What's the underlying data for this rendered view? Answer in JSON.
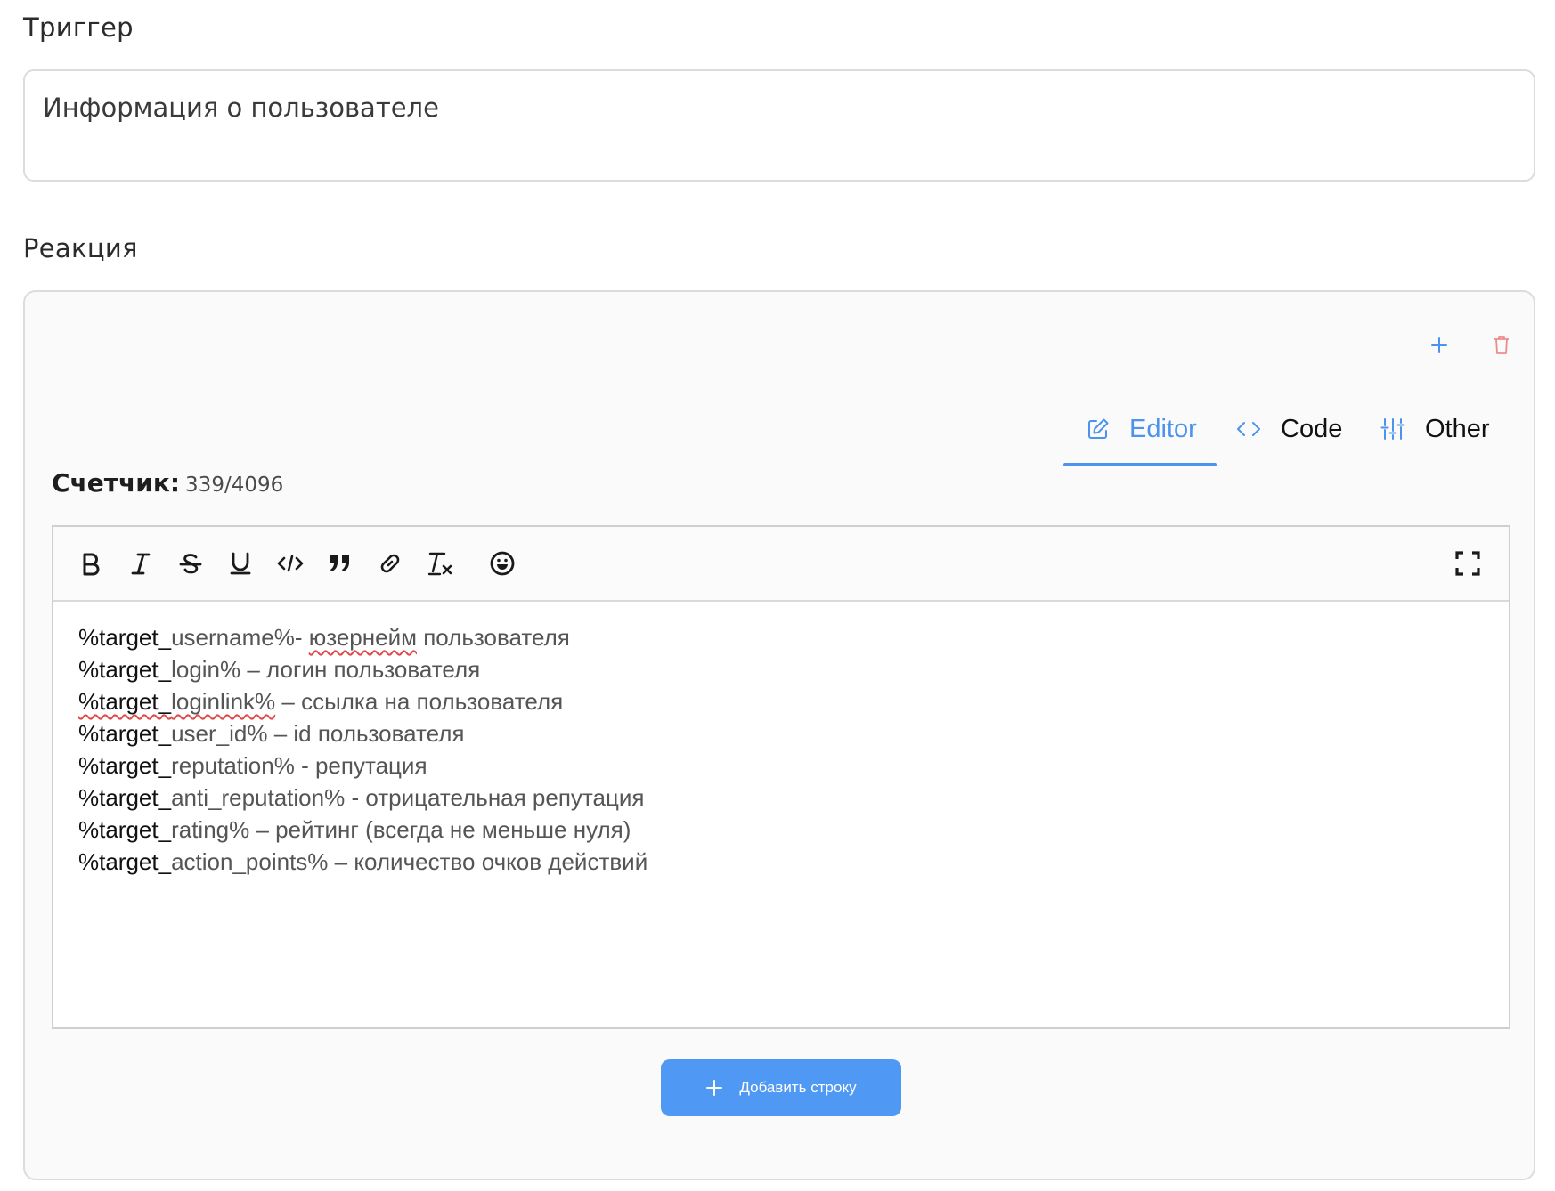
{
  "trigger": {
    "label": "Триггер",
    "value": "Информация о пользователе"
  },
  "reaction": {
    "label": "Реакция",
    "actions": {
      "add_icon": "plus-icon",
      "delete_icon": "trash-icon"
    },
    "tabs": [
      {
        "label": "Editor",
        "icon": "edit-icon",
        "active": true
      },
      {
        "label": "Code",
        "icon": "code-icon",
        "active": false
      },
      {
        "label": "Other",
        "icon": "sliders-icon",
        "active": false
      }
    ],
    "counter": {
      "label": "Счетчик:",
      "value": "339/4096"
    },
    "toolbar": {
      "buttons": [
        "bold-icon",
        "italic-icon",
        "strikethrough-icon",
        "underline-icon",
        "code-inline-icon",
        "quote-icon",
        "link-icon",
        "clear-format-icon",
        "emoji-icon"
      ],
      "fullscreen_icon": "fullscreen-icon"
    },
    "content": {
      "lines": [
        {
          "prefix": "%target_",
          "var": "username%",
          "desc": "- юзернейм пользователя"
        },
        {
          "prefix": "%target_",
          "var": "login%",
          "desc": " – логин пользователя"
        },
        {
          "prefix": "%target_",
          "var": "loginlink%",
          "desc": " – ссылка на пользователя"
        },
        {
          "prefix": "%target_",
          "var": "user_id%",
          "desc": " – id пользователя"
        },
        {
          "prefix": "%target_",
          "var": "reputation%",
          "desc": " - репутация"
        },
        {
          "prefix": "%target_",
          "var": "anti_reputation%",
          "desc": " - отрицательная репутация"
        },
        {
          "prefix": "%target_",
          "var": "rating%",
          "desc": " – рейтинг (всегда не меньше нуля)"
        },
        {
          "prefix": "%target_",
          "var": "action_points%",
          "desc": " – количество очков действий"
        }
      ]
    },
    "add_row_button": "Добавить строку"
  },
  "colors": {
    "accent": "#4c93ee",
    "button": "#4f98f3",
    "delete": "#f08a8a",
    "spellcheck": "#e04848"
  }
}
